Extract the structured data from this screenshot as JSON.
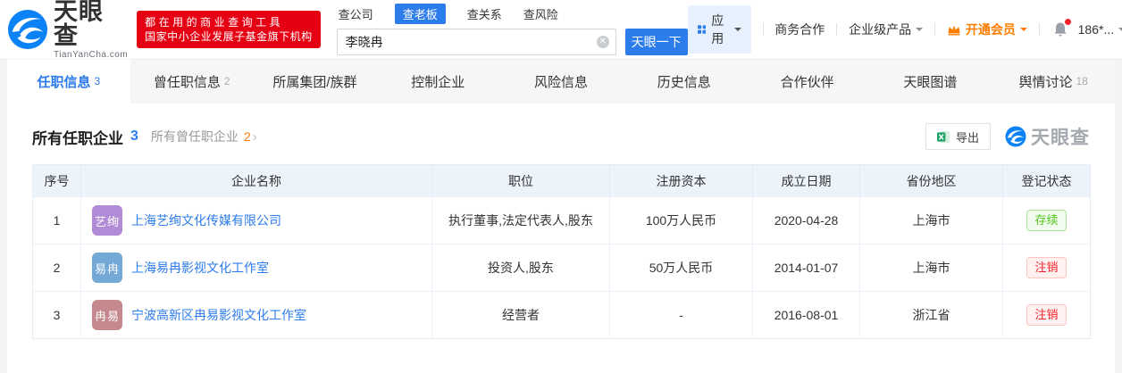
{
  "colors": {
    "accent": "#2d7ceb",
    "logo_blue": "#0b83f6",
    "promo_red": "#e60013",
    "vip_orange": "#ff7d00",
    "status_active_green": "#52c41a",
    "status_cancelled_red": "#f5222d"
  },
  "header": {
    "logo": {
      "title": "天眼查",
      "subtitle": "TianYanCha.com"
    },
    "promo": {
      "line1": "都在用的商业查询工具",
      "line2": "国家中小企业发展子基金旗下机构"
    },
    "search": {
      "tabs": [
        {
          "label": "查公司"
        },
        {
          "label": "查老板"
        },
        {
          "label": "查关系"
        },
        {
          "label": "查风险"
        }
      ],
      "value": "李晓冉",
      "button_label": "天眼一下"
    },
    "nav": {
      "apps": "应用",
      "cooperation": "商务合作",
      "enterprise": "企业级产品",
      "vip": "开通会员",
      "phone": "186*..."
    }
  },
  "tabs": [
    {
      "label": "任职信息",
      "count": "3"
    },
    {
      "label": "曾任职信息",
      "count": "2"
    },
    {
      "label": "所属集团/族群",
      "count": ""
    },
    {
      "label": "控制企业",
      "count": ""
    },
    {
      "label": "风险信息",
      "count": ""
    },
    {
      "label": "历史信息",
      "count": ""
    },
    {
      "label": "合作伙伴",
      "count": ""
    },
    {
      "label": "天眼图谱",
      "count": ""
    },
    {
      "label": "舆情讨论",
      "count": "18"
    }
  ],
  "section": {
    "title": "所有任职企业",
    "count": "3",
    "alt_title": "所有曾任职企业",
    "alt_count": "2",
    "export_label": "导出",
    "watermark": "天眼查"
  },
  "table": {
    "columns": [
      "序号",
      "企业名称",
      "职位",
      "注册资本",
      "成立日期",
      "省份地区",
      "登记状态"
    ],
    "rows": [
      {
        "seq": "1",
        "logo_text": "艺绚",
        "logo_color": "#b18bd5",
        "name": "上海艺绚文化传媒有限公司",
        "position": "执行董事,法定代表人,股东",
        "capital": "100万人民币",
        "date": "2020-04-28",
        "region": "上海市",
        "status": "存续"
      },
      {
        "seq": "2",
        "logo_text": "易冉",
        "logo_color": "#74a8d6",
        "name": "上海易冉影视文化工作室",
        "position": "投资人,股东",
        "capital": "50万人民币",
        "date": "2014-01-07",
        "region": "上海市",
        "status": "注销"
      },
      {
        "seq": "3",
        "logo_text": "冉易",
        "logo_color": "#c5888c",
        "name": "宁波高新区冉易影视文化工作室",
        "position": "经营者",
        "capital": "-",
        "date": "2016-08-01",
        "region": "浙江省",
        "status": "注销"
      }
    ]
  }
}
